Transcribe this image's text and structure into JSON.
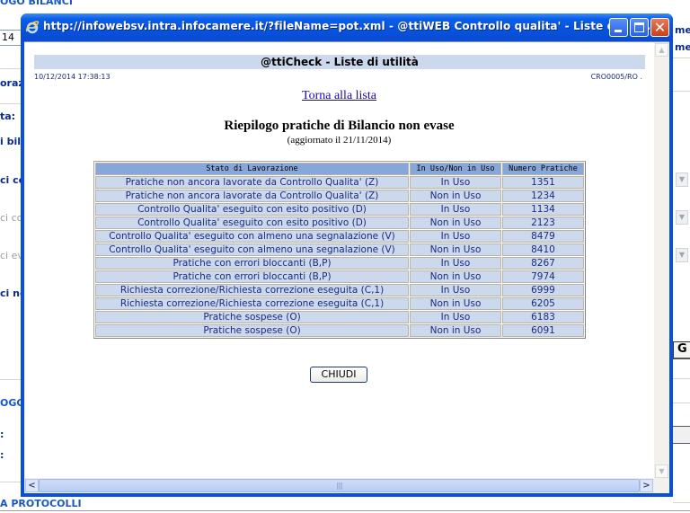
{
  "background": {
    "top_heading": "OGO BILANCI",
    "date_fragment": "14",
    "label_oraz": "oraz",
    "label_ta": "ta:",
    "label_bil": "i bil",
    "label_cico": "ci co",
    "label_cico2": "ci co",
    "label_cie": "ci ev",
    "label_cine": "ci ne",
    "right_mes1": "mes",
    "right_mes2": "mes",
    "right_button": "G",
    "label_ogo": "OGO",
    "colon1": ":",
    "colon2": ":",
    "bottom_link": "A PROTOCOLLI"
  },
  "window": {
    "title": "http://infowebsv.intra.infocamere.it/?fileName=pot.xml - @ttiWEB Controllo qualita' - Liste di  - Wi...",
    "controls": {
      "minimize": "minimize",
      "maximize": "maximize",
      "close": "✕"
    }
  },
  "page": {
    "header": "@ttiCheck - Liste di utilità",
    "timestamp": "10/12/2014 17:38:13",
    "code": "CRO0005/RO .",
    "back_link": "Torna alla lista",
    "title": "Riepilogo pratiche di Bilancio non evase",
    "subtitle": "(aggiornato il 21/11/2014)",
    "table": {
      "headers": [
        "Stato di Lavorazione",
        "In Uso/Non in Uso",
        "Numero Pratiche"
      ],
      "rows": [
        [
          "Pratiche non ancora lavorate da Controllo Qualita' (Z)",
          "In Uso",
          "1351"
        ],
        [
          "Pratiche non ancora lavorate da Controllo Qualita' (Z)",
          "Non in Uso",
          "1234"
        ],
        [
          "Controllo Qualita' eseguito con esito positivo (D)",
          "In Uso",
          "1134"
        ],
        [
          "Controllo Qualita' eseguito con esito positivo (D)",
          "Non in Uso",
          "2123"
        ],
        [
          "Controllo Qualita' eseguito con almeno una segnalazione (V)",
          "In Uso",
          "8479"
        ],
        [
          "Controllo Qualita' eseguito con almeno una segnalazione (V)",
          "Non in Uso",
          "8410"
        ],
        [
          "Pratiche con errori bloccanti (B,P)",
          "In Uso",
          "8267"
        ],
        [
          "Pratiche con errori bloccanti (B,P)",
          "Non in Uso",
          "7974"
        ],
        [
          "Richiesta correzione/Richiesta correzione eseguita (C,1)",
          "In Uso",
          "6999"
        ],
        [
          "Richiesta correzione/Richiesta correzione eseguita (C,1)",
          "Non in Uso",
          "6205"
        ],
        [
          "Pratiche sospese (O)",
          "In Uso",
          "6183"
        ],
        [
          "Pratiche sospese (O)",
          "Non in Uso",
          "6091"
        ]
      ]
    },
    "close_button": "CHIUDI"
  },
  "scrollbars": {
    "up_arrow": "▲",
    "down_arrow": "▼",
    "left_arrow": "<",
    "right_arrow": ">",
    "thumb_grip": "||||"
  }
}
